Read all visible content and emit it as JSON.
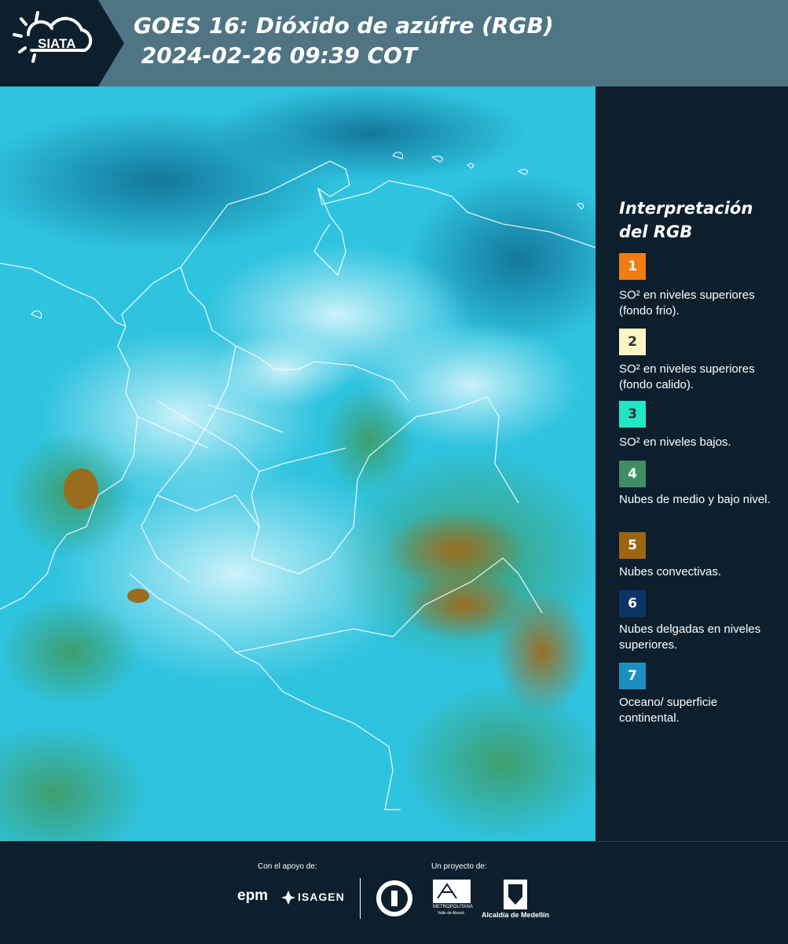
{
  "header": {
    "logo_text": "SIATA",
    "title_line1": "GOES 16: Dióxido de azúfre (RGB)",
    "title_line2": " 2024-02-26 09:39 COT"
  },
  "legend": {
    "title_line1": "Interpretación",
    "title_line2": "del RGB",
    "items": [
      {
        "number": "1",
        "color": "#f07d12",
        "number_color": "#ffffff",
        "text": "SO² en niveles superiores (fondo frio)."
      },
      {
        "number": "2",
        "color": "#fdf6c4",
        "number_color": "#333333",
        "text": "SO² en niveles superiores (fondo calido)."
      },
      {
        "number": "3",
        "color": "#23e6c8",
        "number_color": "#333333",
        "text": "SO² en niveles bajos."
      },
      {
        "number": "4",
        "color": "#3e8e64",
        "number_color": "#ffffff",
        "text": "Nubes de medio y bajo nivel."
      },
      {
        "number": "5",
        "color": "#9c6512",
        "number_color": "#ffffff",
        "text": "Nubes convectivas."
      },
      {
        "number": "6",
        "color": "#0e3366",
        "number_color": "#ffffff",
        "text": "Nubes delgadas en niveles superiores."
      },
      {
        "number": "7",
        "color": "#1c8fc0",
        "number_color": "#ffffff",
        "text": "Oceano/ superficie continental."
      }
    ]
  },
  "footer": {
    "support_label": "Con el apoyo de:",
    "project_label": "Un proyecto de:",
    "epm": "epm",
    "isagen": "ISAGEN",
    "metropolitana_line1": "METROPOLITANA",
    "metropolitana_line2": "Valle de Aburrá",
    "alcaldia": "Alcaldía de Medellín"
  }
}
